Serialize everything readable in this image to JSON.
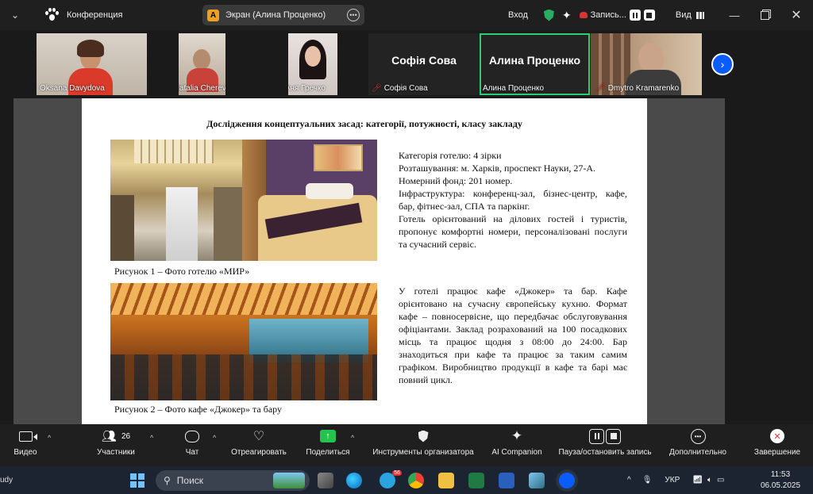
{
  "titlebar": {
    "app_name": "Конференция",
    "screen_pill_badge": "A",
    "screen_pill_text": "Экран (Алина Проценко)",
    "login": "Вход",
    "recording": "Запись...",
    "view": "Вид",
    "icons": [
      "chevron-down-icon",
      "zoom-paw-icon",
      "shield-check-icon",
      "sparkle-icon",
      "record-icon",
      "pause-icon",
      "stop-icon",
      "grid-icon",
      "minimize-icon",
      "restore-icon",
      "close-icon"
    ]
  },
  "participants": [
    {
      "name": "Oksana Davydova",
      "muted": false
    },
    {
      "name": "Natalia Cherevichna",
      "muted": true
    },
    {
      "name": "Аня Гречко",
      "muted": true
    },
    {
      "name": "Софія Сова",
      "muted": true,
      "big_name": "Софія Сова"
    },
    {
      "name": "Алина Проценко",
      "muted": false,
      "big_name": "Алина Проценко",
      "active_speaker": true
    },
    {
      "name": "Dmytro Kramarenko",
      "muted": true
    }
  ],
  "document": {
    "title": "Дослідження концептуальних засад: категорії, потужності, класу закладу",
    "caption1": "Рисунок 1 – Фото готелю «МИР»",
    "caption2": "Рисунок 2 – Фото кафе «Джокер» та бару",
    "block1_lines": [
      "Категорія готелю: 4 зірки",
      "Розташування: м. Харків, проспект Науки, 27-А.",
      "Номерний фонд: 201 номер.",
      "Інфраструктура: конференц-зал, бізнес-центр, кафе, бар, фітнес-зал, СПА та паркінг.",
      "Готель орієнтований на ділових гостей і туристів, пропонує комфортні номери, персоналізовані послуги та сучасний сервіс."
    ],
    "block2": "У готелі працює кафе «Джокер» та бар. Кафе орієнтовано на сучасну європейську кухню. Формат кафе – повносервісне, що передбачає обслуговування офіціантами. Заклад розрахований на 100 посадкових місць та працює щодня з 08:00 до 24:00. Бар знаходиться при кафе та працює за таким самим графіком. Виробництво продукції в кафе та барі має повний цикл."
  },
  "toolbar": {
    "video": "Видео",
    "participants": "Участники",
    "participants_count": "26",
    "chat": "Чат",
    "react": "Отреагировать",
    "share": "Поделиться",
    "host_tools": "Инструменты организатора",
    "ai": "AI Companion",
    "pause_rec": "Пауза/остановить запись",
    "more": "Дополнительно",
    "end": "Завершение"
  },
  "taskbar": {
    "left_text": "udy",
    "search": "Поиск",
    "lang": "УКР",
    "time": "11:53",
    "date": "06.05.2025",
    "telegram_badge": "56"
  },
  "colors": {
    "accent": "#0b5cff",
    "active_speaker_border": "#2ecc71",
    "end_red": "#e03030",
    "share_green": "#27c24c"
  }
}
